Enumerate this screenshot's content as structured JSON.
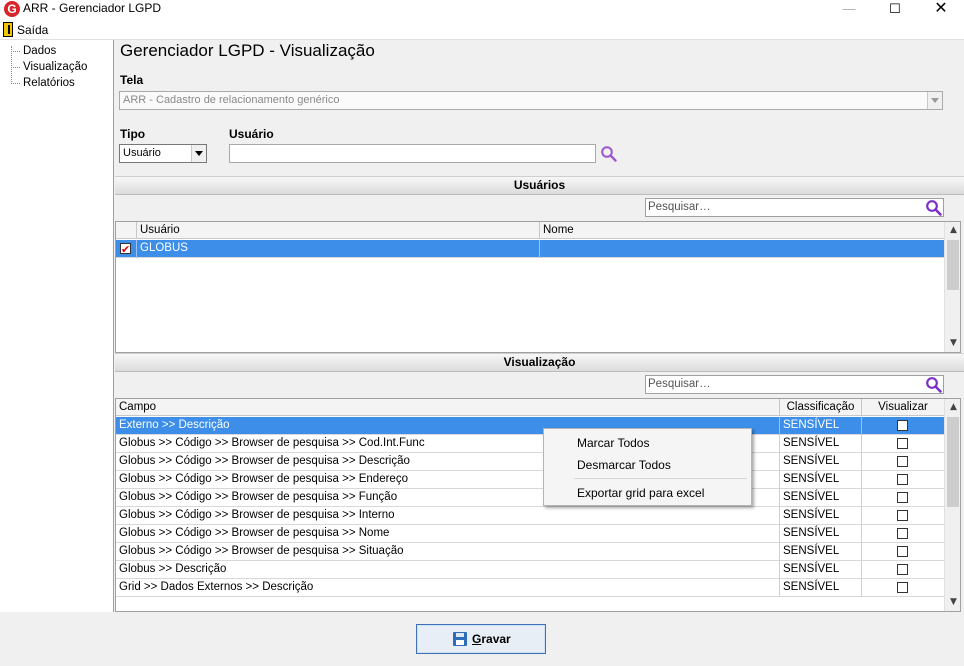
{
  "window": {
    "title": "ARR - Gerenciador LGPD",
    "logo_letter": "G"
  },
  "menu": {
    "exit_label": "Saída"
  },
  "sidebar": {
    "items": [
      "Dados",
      "Visualização",
      "Relatórios"
    ]
  },
  "page_title": "Gerenciador LGPD - Visualização",
  "tela": {
    "label": "Tela",
    "value": "ARR - Cadastro de relacionamento genérico"
  },
  "tipo": {
    "label": "Tipo",
    "value": "Usuário"
  },
  "usuario": {
    "label": "Usuário",
    "value": ""
  },
  "users_section": {
    "title": "Usuários",
    "search_placeholder": "Pesquisar…",
    "columns": [
      "Usuário",
      "Nome"
    ],
    "rows": [
      {
        "checked": true,
        "usuario": "GLOBUS",
        "nome": ""
      }
    ]
  },
  "view_section": {
    "title": "Visualização",
    "search_placeholder": "Pesquisar…",
    "columns": [
      "Campo",
      "Classificação",
      "Visualizar"
    ],
    "rows": [
      {
        "campo": "Externo >> Descrição",
        "classificacao": "SENSÍVEL",
        "visualizar": false
      },
      {
        "campo": "Globus >> Código >> Browser de pesquisa >> Cod.Int.Func",
        "classificacao": "SENSÍVEL",
        "visualizar": false
      },
      {
        "campo": "Globus >> Código >> Browser de pesquisa >> Descrição",
        "classificacao": "SENSÍVEL",
        "visualizar": false
      },
      {
        "campo": "Globus >> Código >> Browser de pesquisa >> Endereço",
        "classificacao": "SENSÍVEL",
        "visualizar": false
      },
      {
        "campo": "Globus >> Código >> Browser de pesquisa >> Função",
        "classificacao": "SENSÍVEL",
        "visualizar": false
      },
      {
        "campo": "Globus >> Código >> Browser de pesquisa >> Interno",
        "classificacao": "SENSÍVEL",
        "visualizar": false
      },
      {
        "campo": "Globus >> Código >> Browser de pesquisa >> Nome",
        "classificacao": "SENSÍVEL",
        "visualizar": false
      },
      {
        "campo": "Globus >> Código >> Browser de pesquisa >> Situação",
        "classificacao": "SENSÍVEL",
        "visualizar": false
      },
      {
        "campo": "Globus >> Descrição",
        "classificacao": "SENSÍVEL",
        "visualizar": false
      },
      {
        "campo": "Grid >> Dados Externos >>  Descrição",
        "classificacao": "SENSÍVEL",
        "visualizar": false
      }
    ]
  },
  "context_menu": {
    "items": [
      "Marcar Todos",
      "Desmarcar Todos",
      "Exportar grid para excel"
    ]
  },
  "save_button": {
    "label_first": "G",
    "label_rest": "ravar"
  },
  "colors": {
    "selection": "#3c8ee9",
    "search_icon": "#7b2fc9",
    "logo": "#d9252a"
  }
}
